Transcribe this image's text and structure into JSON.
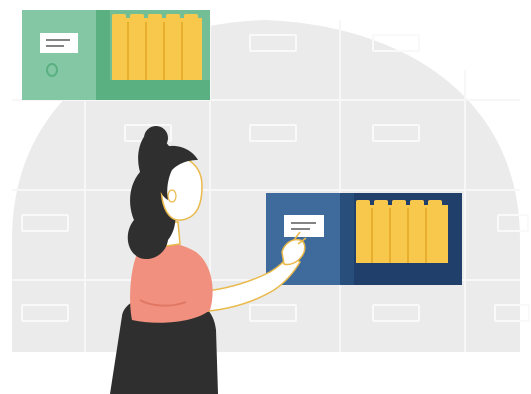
{
  "illustration": {
    "subject": "woman-filing-documents",
    "colors": {
      "background_arch": "#ebebeb",
      "cabinet_lines": "#f6f6f6",
      "cabinet_label": "#ffffff",
      "green_box_front": "#84c7a4",
      "green_box_side": "#5bb081",
      "green_shelf": "#74be96",
      "blue_box_front": "#3e6a9c",
      "blue_box_side": "#284f7c",
      "blue_shelf": "#203f6a",
      "folder_yellow": "#f7c84b",
      "folder_yellow_shade": "#e7af2d",
      "hair": "#2f2f2f",
      "skin": "#ffffff",
      "top_coral": "#f1907e",
      "top_coral_shade": "#e07864",
      "skirt": "#2f2f2f",
      "outline": "#e9b94a"
    },
    "icons": {
      "label_card": "label-card-icon",
      "drawer_handle": "drawer-handle-icon"
    }
  }
}
